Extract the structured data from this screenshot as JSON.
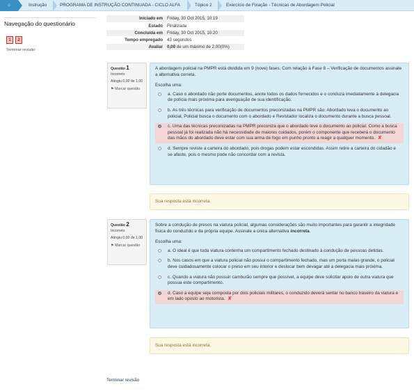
{
  "breadcrumb": {
    "items": [
      "Instrução",
      "PROGRAMA DE INSTRUÇÃO CONTINUADA - CICLO ALFA",
      "Tópico 2",
      "Exercício de Fixação - Técnicas de Abordagem Policial"
    ]
  },
  "nav": {
    "title": "Navegação do questionário",
    "buttons": [
      "1",
      "2"
    ],
    "finish_review": "Terminar revisão"
  },
  "summary": {
    "rows": [
      {
        "label": "Iniciado em",
        "value": "Friday, 30 Oct 2015, 10:19"
      },
      {
        "label": "Estado",
        "value": "Finalizada"
      },
      {
        "label": "Concluída em",
        "value": "Friday, 30 Oct 2015, 10:20"
      },
      {
        "label": "Tempo empregado",
        "value": "43 segundos"
      },
      {
        "label": "Avaliar",
        "value_bold": "0,00",
        "value_rest": " de um máximo de 2,00(0%)"
      }
    ]
  },
  "questions": [
    {
      "label": "Questão",
      "number": "1",
      "status": "Incorreto",
      "grade": "Atingiu 0,00 de 1,00",
      "flag": "Marcar questão",
      "text": "A abordagem policial na PMPR está dividida em 9 (nove) fases. Com relação à Fase 8 – Verificação de documentos assinale a alternativa correta.",
      "prompt": "Escolha uma:",
      "options": [
        "a. Caso o abordado não porte documentos, anote todos os dados fornecidos e o conduza imediatamente à delegacia de polícia mais próxima para averiguação de sua identificação.",
        "b. As três técnicas para verificação de documentos preconizadas na PMPR são: Abordado leva o documento ao policial, Policial busca o documento com o abordado e Revistador localiza o documento durante a busca pessoal.",
        "c. Uma das técnicas preconizadas na PMPR preconiza que o abordado leve o documento ao policial. Como a busca pessoal já foi realizada não há necessidade de maiores cuidados, porém o componente que receberá o documento das mãos do abordado deve estar com sua arma de fogo em punho pronto a reagir a qualquer momento.",
        "d. Sempre reviste a carteira do abordado, pois drogas podem estar escondidas. Assim retire a carteira do cidadão e se afaste, pois o mesmo pode não concordar com a revista."
      ],
      "selected": 2,
      "feedback": "Sua resposta está incorreta."
    },
    {
      "label": "Questão",
      "number": "2",
      "status": "Incorreto",
      "grade": "Atingiu 0,00 de 1,00",
      "flag": "Marcar questão",
      "text_parts": [
        "Sobre a condução de presos na viatura policial, algumas considerações são muito importantes para garantir a integridade física do conduzido e da própria equipe. Assinale a única alternativa ",
        "incorreta",
        "."
      ],
      "prompt": "Escolha uma:",
      "options": [
        "a. O ideal é que toda viatura contenha um compartimento fechado destinado à condução de pessoas detidas.",
        "b. Nos casos em que a viatura policial não possui o compartimento fechado, mas um porta malas grande, o policial deve cuidadosamente colocar o preso em seu interior e deslocar bem devagar até a delegacia mais próxima.",
        "c. Quando a viatura não possuir camburão sempre que possível, a equipe deve solicitar apoio de outra viatura que possua este compartimento.",
        "d. Caso a equipe seja composta por dois policiais militares, o conduzido deverá sentar no banco traseiro da viatura e em lado oposto ao motorista."
      ],
      "selected": 3,
      "feedback": "Sua resposta está incorreta."
    }
  ],
  "footer": {
    "finish_review": "Terminar revisão"
  },
  "icons": {
    "home": "home-icon",
    "flag": "flag-icon",
    "wrong": "cross-icon"
  },
  "colors": {
    "breadcrumb_bg": "#d9edf7",
    "home_bg": "#3a8fc5",
    "question_bg": "#d9edf7",
    "selected_wrong_bg": "#f2d6d6",
    "feedback_bg": "#fcf8e3",
    "wrong_mark": "#d9534f"
  }
}
